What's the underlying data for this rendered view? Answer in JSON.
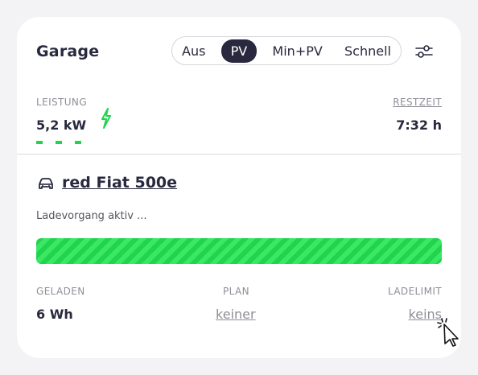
{
  "title": "Garage",
  "modes": [
    {
      "label": "Aus",
      "active": false
    },
    {
      "label": "PV",
      "active": true
    },
    {
      "label": "Min+PV",
      "active": false
    },
    {
      "label": "Schnell",
      "active": false
    }
  ],
  "settings_icon": "sliders-icon",
  "power": {
    "label": "LEISTUNG",
    "value": "5,2 kW",
    "icon": "lightning-bolt-icon"
  },
  "remaining": {
    "label": "RESTZEIT",
    "value": "7:32 h"
  },
  "vehicle": {
    "name": "red Fiat 500e",
    "icon": "car-icon"
  },
  "status": "Ladevorgang aktiv ...",
  "progress": {
    "color": "#20d44c",
    "fill_fraction": 1.0
  },
  "charged": {
    "label": "GELADEN",
    "value": "6 Wh"
  },
  "plan": {
    "label": "PLAN",
    "value": "keiner"
  },
  "limit": {
    "label": "LADELIMIT",
    "value": "keins"
  },
  "colors": {
    "accent": "#28293e",
    "green": "#20d44c",
    "muted": "#8e8e98",
    "background": "#f3f3f6"
  }
}
